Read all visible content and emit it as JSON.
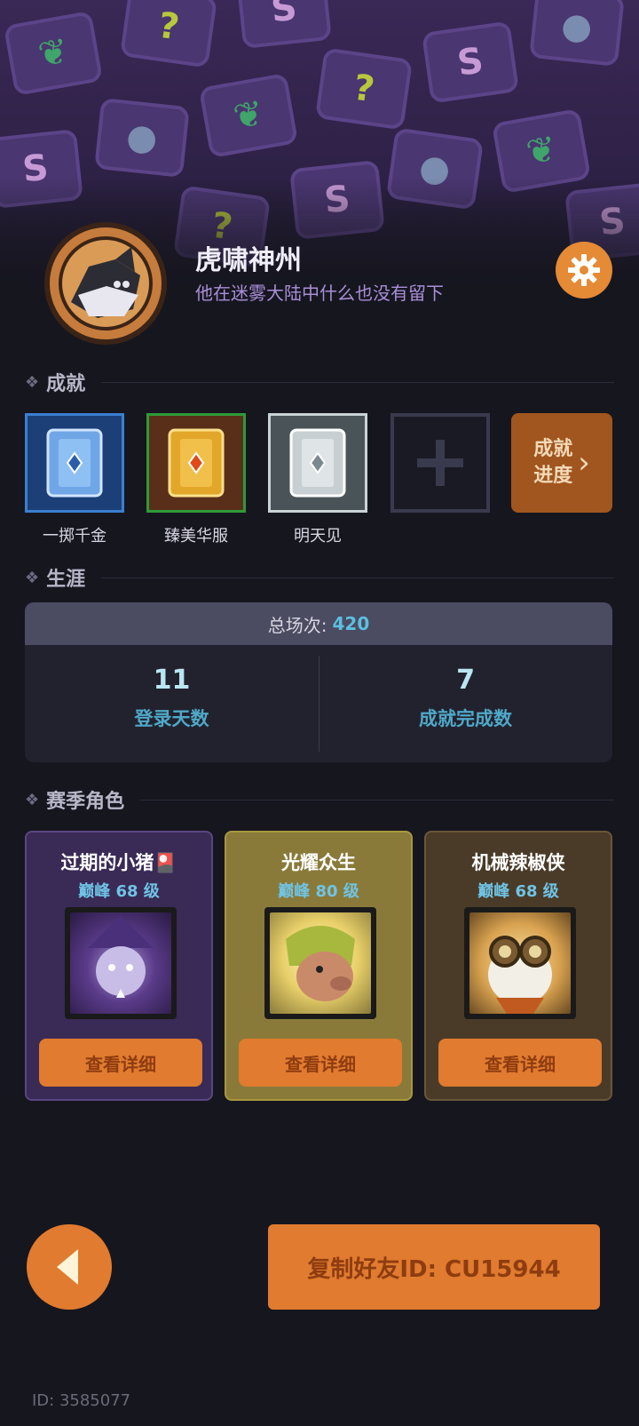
{
  "profile": {
    "name": "虎啸神州",
    "bio": "他在迷雾大陆中什么也没有留下"
  },
  "sections": {
    "achievements": "成就",
    "career": "生涯",
    "season_roles": "赛季角色"
  },
  "achievements": {
    "items": [
      {
        "label": "一掷千金",
        "icon": "blue-card-icon"
      },
      {
        "label": "臻美华服",
        "icon": "gold-card-icon"
      },
      {
        "label": "明天见",
        "icon": "silver-card-icon"
      }
    ],
    "empty_slot_icon": "plus-icon",
    "progress_label": "成就进度",
    "progress_label_line1": "成就",
    "progress_label_line2": "进度"
  },
  "career": {
    "total_label": "总场次:",
    "total_value": "420",
    "login_days_value": "11",
    "login_days_label": "登录天数",
    "achievements_done_value": "7",
    "achievements_done_label": "成就完成数"
  },
  "season_cards": [
    {
      "title": "过期的小猪🎴",
      "tier": "巅峰 68 级",
      "button": "查看详细",
      "bg": "#3a2a56"
    },
    {
      "title": "光耀众生",
      "tier": "巅峰 80 级",
      "button": "查看详细",
      "bg": "#8a7a3a"
    },
    {
      "title": "机械辣椒侠",
      "tier": "巅峰 68 级",
      "button": "查看详细",
      "bg": "#4a3b28"
    }
  ],
  "footer": {
    "copy_button": "复制好友ID: CU15944",
    "player_id": "ID: 3585077"
  },
  "colors": {
    "accent": "#e07b2f",
    "background": "#16161f",
    "stat_label": "#4fa8c8"
  }
}
